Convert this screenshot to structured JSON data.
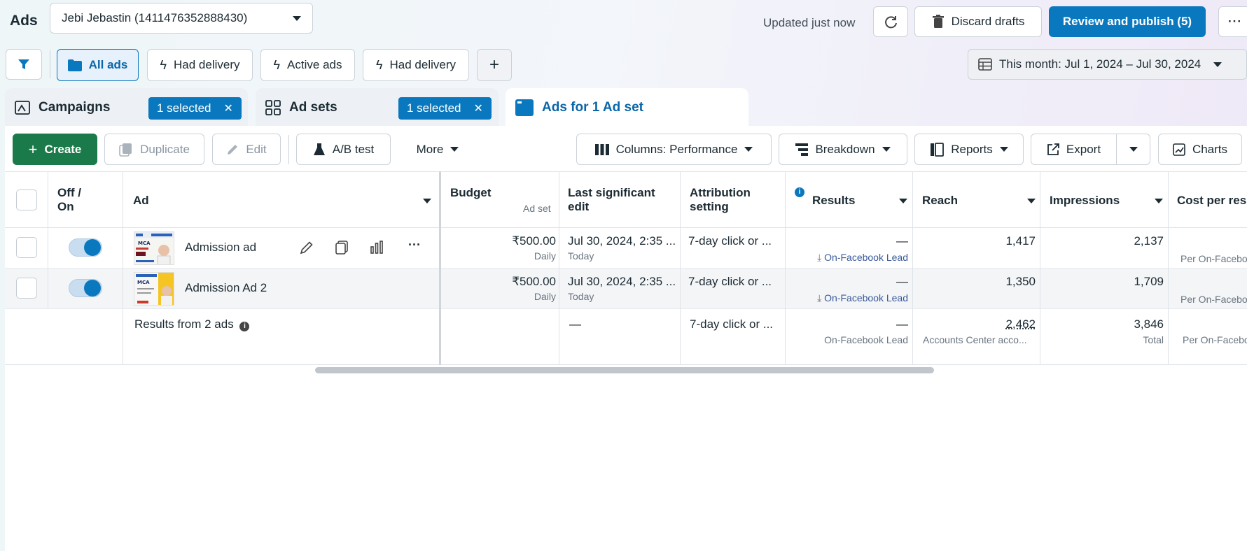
{
  "header": {
    "title": "Ads",
    "account": "Jebi Jebastin (1411476352888430)",
    "status": "Updated just now",
    "discard_label": "Discard drafts",
    "publish_label": "Review and publish (5)",
    "more_label": "···"
  },
  "filters": {
    "items": [
      "All ads",
      "Had delivery",
      "Active ads",
      "Had delivery"
    ],
    "add_label": "+",
    "date_range": "This month: Jul 1, 2024 – Jul 30, 2024"
  },
  "tabs": {
    "campaigns": "Campaigns",
    "campaigns_chip": "1 selected",
    "adsets": "Ad sets",
    "adsets_chip": "1 selected",
    "ads": "Ads for 1 Ad set"
  },
  "toolbar": {
    "create": "Create",
    "duplicate": "Duplicate",
    "edit": "Edit",
    "ab_test": "A/B test",
    "more": "More",
    "columns": "Columns: Performance",
    "breakdown": "Breakdown",
    "reports": "Reports",
    "export": "Export",
    "charts": "Charts"
  },
  "table": {
    "headers": {
      "offon": "Off / On",
      "ad": "Ad",
      "budget": "Budget",
      "budget_sub": "Ad set",
      "last_edit": "Last significant edit",
      "attribution": "Attribution setting",
      "results": "Results",
      "reach": "Reach",
      "impressions": "Impressions",
      "cost": "Cost per res"
    },
    "rows": [
      {
        "name": "Admission ad",
        "budget": "₹500.00",
        "budget_sub": "Daily",
        "last_edit": "Jul 30, 2024, 2:35 ...",
        "last_edit_sub": "Today",
        "attribution": "7-day click or ...",
        "results": "—",
        "results_sub": "On-Facebook Lead",
        "reach": "1,417",
        "impressions": "2,137",
        "cost_sub": "Per On-Facebo",
        "thumb_text": "MCA"
      },
      {
        "name": "Admission Ad 2",
        "budget": "₹500.00",
        "budget_sub": "Daily",
        "last_edit": "Jul 30, 2024, 2:35 ...",
        "last_edit_sub": "Today",
        "attribution": "7-day click or ...",
        "results": "—",
        "results_sub": "On-Facebook Lead",
        "reach": "1,350",
        "impressions": "1,709",
        "cost_sub": "Per On-Facebo",
        "thumb_text": "MCA"
      }
    ],
    "footer": {
      "label": "Results from 2 ads",
      "last_edit": "—",
      "attribution": "7-day click or ...",
      "results": "—",
      "results_sub": "On-Facebook Lead",
      "reach": "2,462",
      "reach_sub": "Accounts Center acco...",
      "impressions": "3,846",
      "impressions_sub": "Total",
      "cost_sub": "Per On-Facebo"
    }
  },
  "colors": {
    "primary": "#0a78be",
    "create": "#1b7a4a",
    "link": "#385898"
  }
}
